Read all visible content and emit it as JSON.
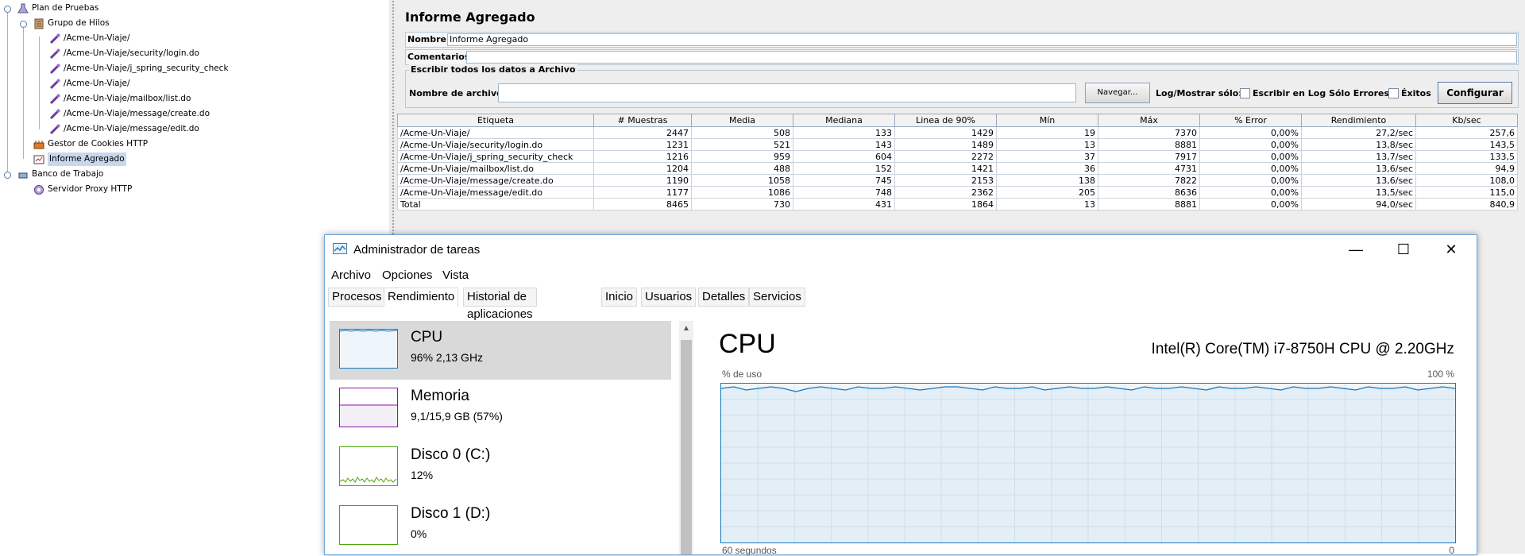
{
  "tree": {
    "items": [
      {
        "label": "Plan de Pruebas",
        "icon": "test-plan-icon"
      },
      {
        "label": "Grupo de Hilos",
        "icon": "thread-group-icon"
      },
      {
        "label": "/Acme-Un-Viaje/",
        "icon": "http-sampler-icon"
      },
      {
        "label": "/Acme-Un-Viaje/security/login.do",
        "icon": "http-sampler-icon"
      },
      {
        "label": "/Acme-Un-Viaje/j_spring_security_check",
        "icon": "http-sampler-icon"
      },
      {
        "label": "/Acme-Un-Viaje/",
        "icon": "http-sampler-icon"
      },
      {
        "label": "/Acme-Un-Viaje/mailbox/list.do",
        "icon": "http-sampler-icon"
      },
      {
        "label": "/Acme-Un-Viaje/message/create.do",
        "icon": "http-sampler-icon"
      },
      {
        "label": "/Acme-Un-Viaje/message/edit.do",
        "icon": "http-sampler-icon"
      },
      {
        "label": "Gestor de Cookies HTTP",
        "icon": "cookie-manager-icon"
      },
      {
        "label": "Informe Agregado",
        "icon": "aggregate-report-icon"
      },
      {
        "label": "Banco de Trabajo",
        "icon": "workbench-icon"
      },
      {
        "label": "Servidor Proxy HTTP",
        "icon": "proxy-server-icon"
      }
    ]
  },
  "report": {
    "title": "Informe Agregado",
    "name_label": "Nombre:",
    "name_value": "Informe Agregado",
    "comments_label": "Comentarios",
    "file_section_label": "Escribir todos los datos a Archivo",
    "file_name_label": "Nombre de archivo",
    "browse_button": "Navegar...",
    "log_label": "Log/Mostrar sólo:",
    "errors_only_label": "Escribir en Log Sólo Errores",
    "successes_label": "Éxitos",
    "configure_button": "Configurar",
    "columns": [
      "Etiqueta",
      "# Muestras",
      "Media",
      "Mediana",
      "Linea de 90%",
      "Mín",
      "Máx",
      "% Error",
      "Rendimiento",
      "Kb/sec"
    ],
    "rows": [
      [
        "/Acme-Un-Viaje/",
        "2447",
        "508",
        "133",
        "1429",
        "19",
        "7370",
        "0,00%",
        "27,2/sec",
        "257,6"
      ],
      [
        "/Acme-Un-Viaje/security/login.do",
        "1231",
        "521",
        "143",
        "1489",
        "13",
        "8881",
        "0,00%",
        "13,8/sec",
        "143,5"
      ],
      [
        "/Acme-Un-Viaje/j_spring_security_check",
        "1216",
        "959",
        "604",
        "2272",
        "37",
        "7917",
        "0,00%",
        "13,7/sec",
        "133,5"
      ],
      [
        "/Acme-Un-Viaje/mailbox/list.do",
        "1204",
        "488",
        "152",
        "1421",
        "36",
        "4731",
        "0,00%",
        "13,6/sec",
        "94,9"
      ],
      [
        "/Acme-Un-Viaje/message/create.do",
        "1190",
        "1058",
        "745",
        "2153",
        "138",
        "7822",
        "0,00%",
        "13,6/sec",
        "108,0"
      ],
      [
        "/Acme-Un-Viaje/message/edit.do",
        "1177",
        "1086",
        "748",
        "2362",
        "205",
        "8636",
        "0,00%",
        "13,5/sec",
        "115,0"
      ],
      [
        "Total",
        "8465",
        "730",
        "431",
        "1864",
        "13",
        "8881",
        "0,00%",
        "94,0/sec",
        "840,9"
      ]
    ]
  },
  "taskmanager": {
    "title": "Administrador de tareas",
    "menu": [
      "Archivo",
      "Opciones",
      "Vista"
    ],
    "tabs": [
      "Procesos",
      "Rendimiento",
      "Historial de aplicaciones",
      "Inicio",
      "Usuarios",
      "Detalles",
      "Servicios"
    ],
    "active_tab": "Rendimiento",
    "sidebar": [
      {
        "name": "CPU",
        "value": "96% 2,13 GHz",
        "color": "#1779ba",
        "level": 0.96
      },
      {
        "name": "Memoria",
        "value": "9,1/15,9 GB (57%)",
        "color": "#8b12ae",
        "level": 0.57
      },
      {
        "name": "Disco 0 (C:)",
        "value": "12%",
        "color": "#4da60c",
        "level": 0.12
      },
      {
        "name": "Disco 1 (D:)",
        "value": "0%",
        "color": "#4da60c",
        "level": 0.0
      }
    ],
    "main": {
      "title": "CPU",
      "model": "Intel(R) Core(TM) i7-8750H CPU @ 2.20GHz",
      "usage_label": "% de uso",
      "max_label": "100 %",
      "time_label": "60 segundos",
      "min_label": "0",
      "cpu_history": [
        97,
        98,
        96,
        97,
        98,
        97,
        95,
        97,
        98,
        97,
        96,
        98,
        97,
        97,
        98,
        97,
        96,
        97,
        98,
        98,
        97,
        96,
        98,
        97,
        97,
        98,
        96,
        97,
        98,
        97,
        97,
        98,
        97,
        96,
        98,
        97,
        97,
        98,
        97,
        96,
        98,
        97,
        97,
        98,
        97,
        96,
        98,
        97,
        97,
        98,
        97,
        96,
        98,
        97,
        97,
        98,
        96,
        97,
        98,
        97
      ]
    }
  }
}
